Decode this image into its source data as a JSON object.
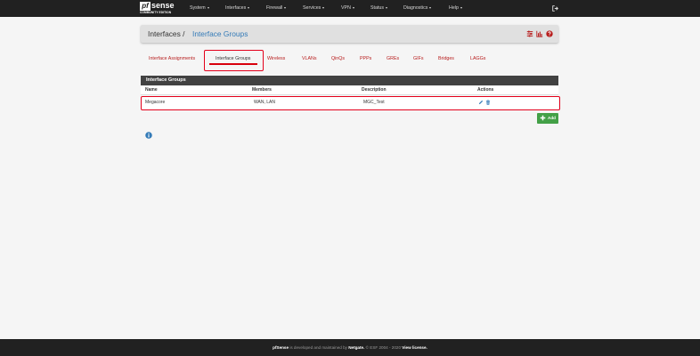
{
  "brand": {
    "logo": "pf",
    "name": "sense",
    "edition": "COMMUNITY EDITION"
  },
  "nav": {
    "items": [
      {
        "label": "System"
      },
      {
        "label": "Interfaces"
      },
      {
        "label": "Firewall"
      },
      {
        "label": "Services"
      },
      {
        "label": "VPN"
      },
      {
        "label": "Status"
      },
      {
        "label": "Diagnostics"
      },
      {
        "label": "Help"
      }
    ],
    "logout_icon": "sign-out-icon"
  },
  "breadcrumb": {
    "parent": "Interfaces /",
    "current": "Interface Groups"
  },
  "breadcrumb_icons": [
    "sliders-icon",
    "bar-chart-icon",
    "question-circle-icon"
  ],
  "tabs": [
    {
      "label": "Interface Assignments"
    },
    {
      "label": "Interface Groups"
    },
    {
      "label": "Wireless"
    },
    {
      "label": "VLANs"
    },
    {
      "label": "QinQs"
    },
    {
      "label": "PPPs"
    },
    {
      "label": "GREs"
    },
    {
      "label": "GIFs"
    },
    {
      "label": "Bridges"
    },
    {
      "label": "LAGGs"
    }
  ],
  "active_tab": "Interface Groups",
  "panel": {
    "title": "Interface Groups",
    "columns": [
      "Name",
      "Members",
      "Description",
      "Actions"
    ],
    "rows": [
      {
        "name": "Megacore",
        "members": "WAN, LAN",
        "description": "MGC_Test",
        "actions": [
          "pencil-icon",
          "trash-icon"
        ]
      }
    ]
  },
  "add_button": {
    "label": "Add",
    "icon": "plus-icon"
  },
  "info_icon": "info-circle-icon",
  "footer": {
    "product": "pfSense",
    "text1": " is developed and maintained by ",
    "company": "Netgate.",
    "text2": " © ESF 2004 - 2020 ",
    "license": "View license."
  },
  "colors": {
    "navbar": "#212121",
    "link": "#337ab7",
    "tab_text": "#b71c1c",
    "highlight": "#e4001b",
    "panel_heading": "#424242",
    "add_button": "#43a047"
  }
}
